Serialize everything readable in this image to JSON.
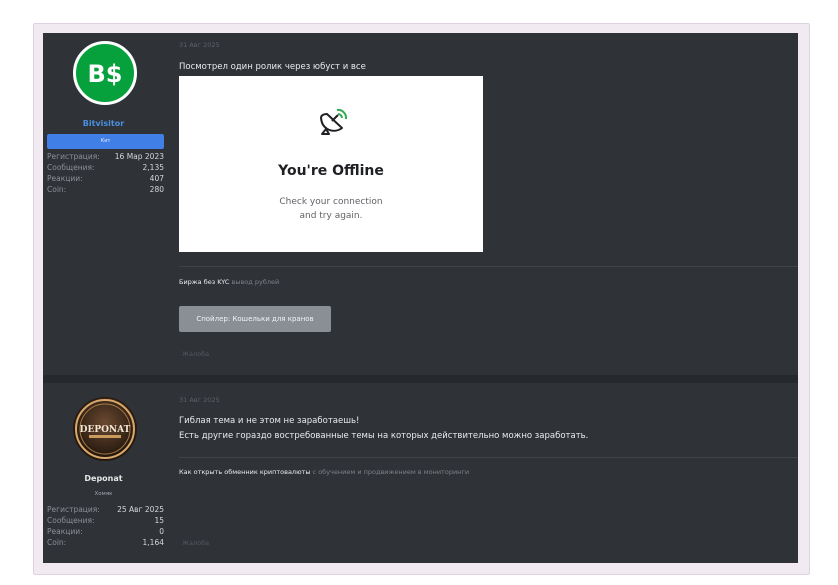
{
  "posts": [
    {
      "user": {
        "name": "Bitvisitor",
        "avatar_text": "B$",
        "rank": "Кит",
        "stats": [
          {
            "label": "Регистрация:",
            "value": "16 Мар 2023"
          },
          {
            "label": "Сообщения:",
            "value": "2,135"
          },
          {
            "label": "Реакции:",
            "value": "407"
          },
          {
            "label": "Coin:",
            "value": "280"
          }
        ]
      },
      "date": "31 Авг 2025",
      "message": "Посмотрел один ролик через юбуст и все",
      "embed": {
        "title": "You're Offline",
        "subtitle_line1": "Check your connection",
        "subtitle_line2": "and try again."
      },
      "signature": {
        "link": "Биржа без KYC",
        "rest": "вывод рублей"
      },
      "spoiler": "Спойлер: Кошельки для кранов",
      "report": "Жалоба"
    },
    {
      "user": {
        "name": "Deponat",
        "avatar_text": "DEPONAT",
        "rank": "Хомяк",
        "stats": [
          {
            "label": "Регистрация:",
            "value": "25 Авг 2025"
          },
          {
            "label": "Сообщения:",
            "value": "15"
          },
          {
            "label": "Реакции:",
            "value": "0"
          },
          {
            "label": "Coin:",
            "value": "1,164"
          }
        ]
      },
      "date": "31 Авг 2025",
      "message_line1": "Гиблая тема и не этом не заработаешь!",
      "message_line2": "Есть другие гораздо востребованные темы на которых действительно можно заработать.",
      "signature": {
        "link": "Как открыть обменник криптовалюты",
        "rest": "с обучением и продвижением в мониторинги"
      },
      "report": "Жалоба"
    }
  ]
}
